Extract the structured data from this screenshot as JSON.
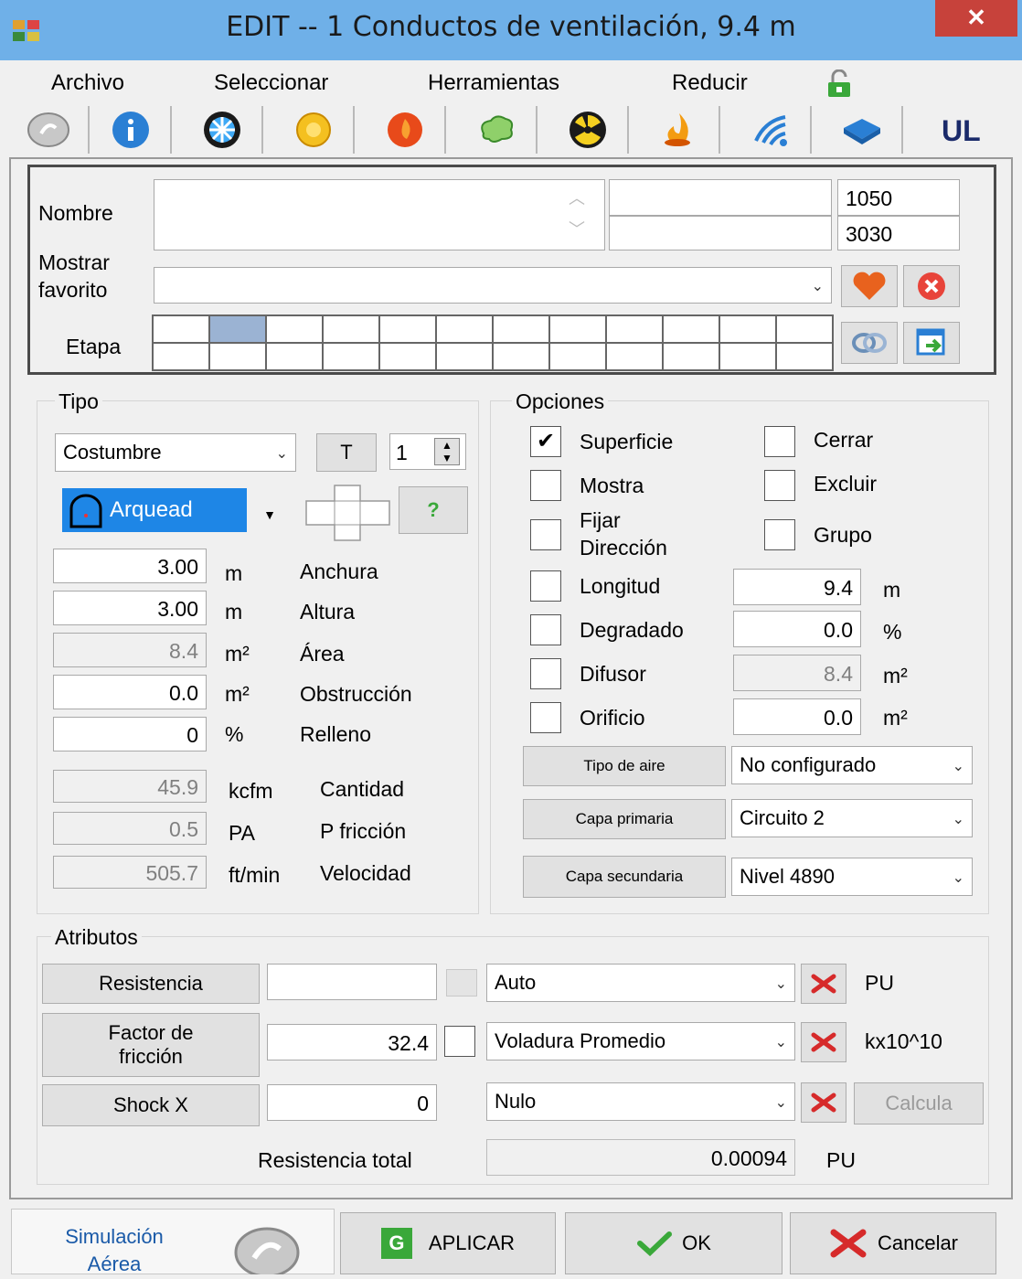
{
  "window": {
    "title": "EDIT -- 1 Conductos de ventilación, 9.4 m",
    "close_glyph": "✕"
  },
  "menu": [
    "Archivo",
    "Seleccionar",
    "Herramientas",
    "Reducir"
  ],
  "menu_lock_icon": "lock-icon",
  "toolbar_icons": [
    "simulation-icon",
    "info-icon",
    "fan-icon",
    "sun-icon",
    "fire-icon",
    "cloud-icon",
    "radiation-icon",
    "flame-icon",
    "wireless-icon",
    "book-icon",
    "ul-icon"
  ],
  "header": {
    "nombre_label": "Nombre",
    "nombre_value": "",
    "code_field_1": "",
    "code_field_2": "",
    "number_1": "1050",
    "number_2": "3030",
    "favorito_label_1": "Mostrar",
    "favorito_label_2": "favorito",
    "favorito_value": "",
    "etapa_label": "Etapa"
  },
  "tipo": {
    "title": "Tipo",
    "type_select": "Costumbre",
    "t_button": "T",
    "spin_value": "1",
    "shape_label": "Arquead",
    "help_button": "?",
    "rows": [
      {
        "value": "3.00",
        "unit": "m",
        "label": "Anchura"
      },
      {
        "value": "3.00",
        "unit": "m",
        "label": "Altura"
      },
      {
        "value": "8.4",
        "unit": "m²",
        "label": "Área"
      },
      {
        "value": "0.0",
        "unit": "m²",
        "label": "Obstrucción"
      },
      {
        "value": "0",
        "unit": "%",
        "label": "Relleno"
      },
      {
        "value": "45.9",
        "unit": "kcfm",
        "label": "Cantidad"
      },
      {
        "value": "0.5",
        "unit": "PA",
        "label": "P fricción"
      },
      {
        "value": "505.7",
        "unit": "ft/min",
        "label": "Velocidad"
      }
    ]
  },
  "opciones": {
    "title": "Opciones",
    "superficie": "Superficie",
    "superficie_checked": "✔",
    "cerrar": "Cerrar",
    "mostra": "Mostra",
    "excluir": "Excluir",
    "fijar_1": "Fijar",
    "fijar_2": "Dirección",
    "grupo": "Grupo",
    "longitud": "Longitud",
    "longitud_value": "9.4",
    "longitud_unit": "m",
    "degradado": "Degradado",
    "degradado_value": "0.0",
    "degradado_unit": "%",
    "difusor": "Difusor",
    "difusor_value": "8.4",
    "difusor_unit": "m²",
    "orificio": "Orificio",
    "orificio_value": "0.0",
    "orificio_unit": "m²",
    "tipo_aire_btn": "Tipo de aire",
    "tipo_aire_value": "No configurado",
    "capa_primaria_btn": "Capa primaria",
    "capa_primaria_value": "Circuito 2",
    "capa_secundaria_btn": "Capa secundaria",
    "capa_secundaria_value": "Nivel 4890"
  },
  "atributos": {
    "title": "Atributos",
    "resistencia_btn": "Resistencia",
    "resistencia_value": "",
    "resistencia_mode": "Auto",
    "resistencia_unit": "PU",
    "factor_btn_1": "Factor de",
    "factor_btn_2": "fricción",
    "factor_value": "32.4",
    "factor_mode": "Voladura Promedio",
    "factor_unit": "kx10^10",
    "shock_btn": "Shock X",
    "shock_value": "0",
    "shock_mode": "Nulo",
    "calcula_btn": "Calcula",
    "total_label": "Resistencia total",
    "total_value": "0.00094",
    "total_unit": "PU"
  },
  "footer": {
    "sim_1": "Simulación",
    "sim_2": "Aérea",
    "aplicar": "APLICAR",
    "aplicar_glyph": "G",
    "ok": "OK",
    "cancelar": "Cancelar"
  }
}
